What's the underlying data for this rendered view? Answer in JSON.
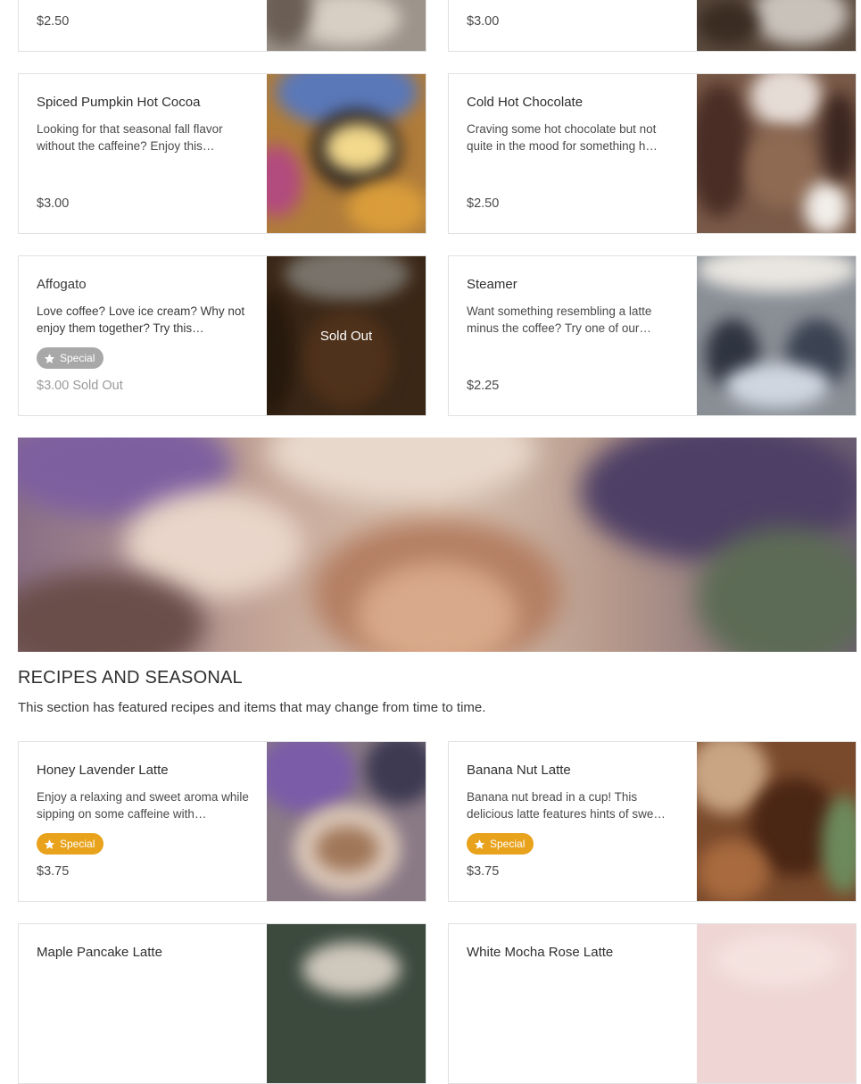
{
  "colors": {
    "special_badge": "#e8a21b",
    "special_badge_disabled": "#a8a8a8",
    "card_border": "#e1e1e1"
  },
  "top_row": [
    {
      "price": "$2.50"
    },
    {
      "price": "$3.00"
    }
  ],
  "items": [
    {
      "name": "Spiced Pumpkin Hot Cocoa",
      "description": "Looking for that seasonal fall flavor without the caffeine? Enjoy this…",
      "price": "$3.00"
    },
    {
      "name": "Cold Hot Chocolate",
      "description": "Craving some hot chocolate but not quite in the mood for something h…",
      "price": "$2.50"
    },
    {
      "name": "Affogato",
      "description": "Love coffee? Love ice cream? Why not enjoy them together? Try this…",
      "badge": "Special",
      "price": "$3.00 Sold Out",
      "overlay": "Sold Out"
    },
    {
      "name": "Steamer",
      "description": "Want something resembling a latte minus the coffee? Try one of our…",
      "price": "$2.25"
    }
  ],
  "section": {
    "title": "RECIPES AND SEASONAL",
    "description": "This section has featured recipes and items that may change from time to time."
  },
  "seasonal_items": [
    {
      "name": "Honey Lavender Latte",
      "description": "Enjoy a relaxing and sweet aroma while sipping on some caffeine with…",
      "badge": "Special",
      "price": "$3.75"
    },
    {
      "name": "Banana Nut Latte",
      "description": "Banana nut bread in a cup! This delicious latte features hints of swe…",
      "badge": "Special",
      "price": "$3.75"
    },
    {
      "name": "Maple Pancake Latte"
    },
    {
      "name": "White Mocha Rose Latte"
    }
  ]
}
